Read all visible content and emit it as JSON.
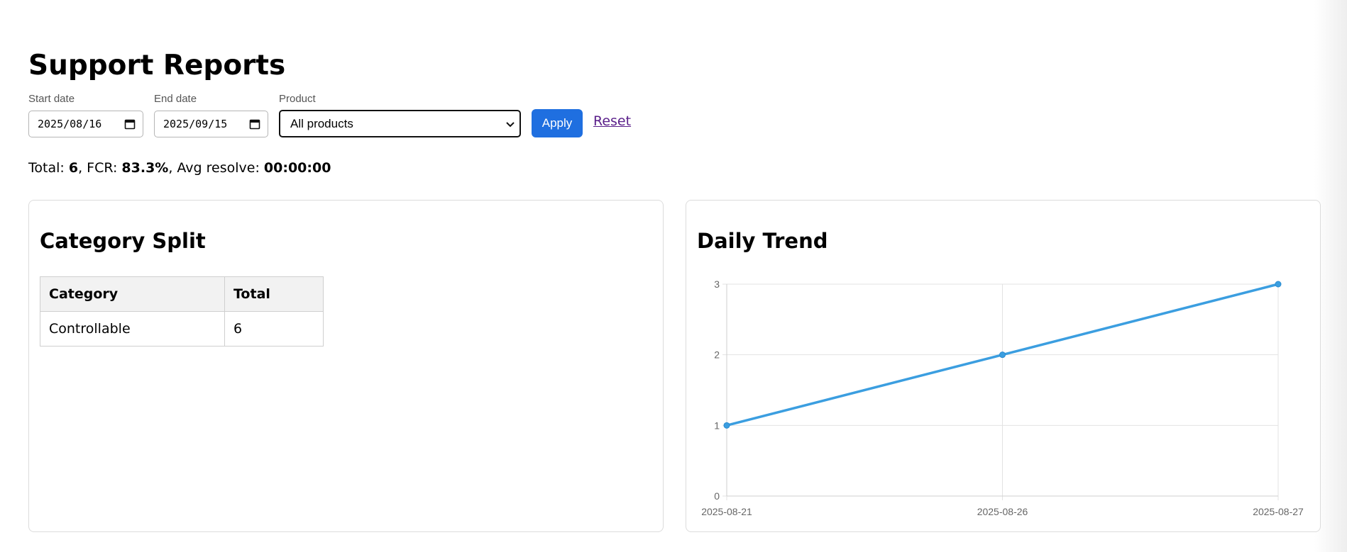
{
  "page": {
    "title": "Support Reports"
  },
  "filters": {
    "start_date": {
      "label": "Start date",
      "value": "2025/08/16"
    },
    "end_date": {
      "label": "End date",
      "value": "2025/09/15"
    },
    "product": {
      "label": "Product",
      "selected": "All products"
    },
    "apply_label": "Apply",
    "reset_label": "Reset"
  },
  "summary": {
    "total_label": "Total: ",
    "total": "6",
    "fcr_label": ", FCR: ",
    "fcr": "83.3%",
    "avg_label": ", Avg resolve: ",
    "avg_resolve": "00:00:00"
  },
  "category_split": {
    "title": "Category Split",
    "headers": [
      "Category",
      "Total"
    ],
    "rows": [
      [
        "Controllable",
        "6"
      ]
    ]
  },
  "daily_trend": {
    "title": "Daily Trend"
  },
  "colors": {
    "accent": "#1f6fe0",
    "line": "#3b9ee0",
    "link": "#5a1f8a"
  },
  "chart_data": {
    "type": "line",
    "x": [
      "2025-08-21",
      "2025-08-26",
      "2025-08-27"
    ],
    "series": [
      {
        "values": [
          1,
          2,
          3
        ]
      }
    ],
    "yticks": [
      0,
      1,
      2,
      3
    ],
    "ylim": [
      0,
      3
    ],
    "grid": true,
    "title": "",
    "xlabel": "",
    "ylabel": ""
  }
}
